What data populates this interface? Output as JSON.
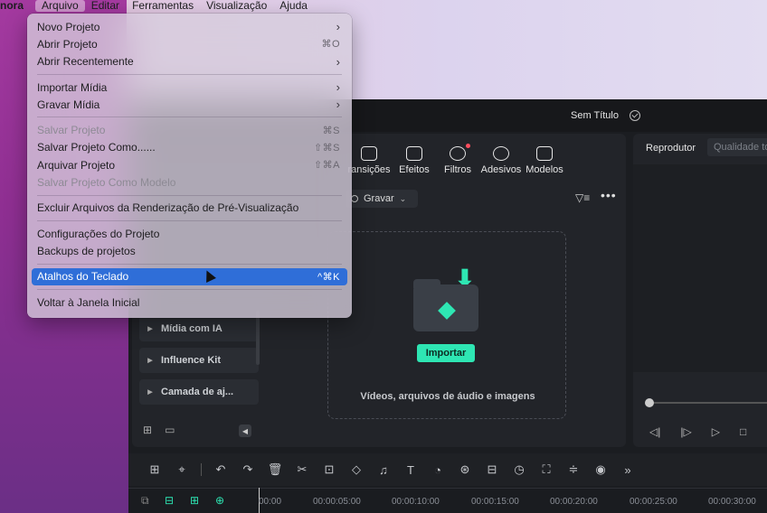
{
  "menubar": {
    "app": "nora",
    "items": [
      "Arquivo",
      "Editar",
      "Ferramentas",
      "Visualização",
      "Ajuda"
    ]
  },
  "file_menu": {
    "groups": [
      [
        {
          "label": "Novo Projeto",
          "shortcut": "",
          "submenu": true,
          "disabled": false
        },
        {
          "label": "Abrir Projeto",
          "shortcut": "⌘O",
          "submenu": false,
          "disabled": false
        },
        {
          "label": "Abrir Recentemente",
          "shortcut": "",
          "submenu": true,
          "disabled": false
        }
      ],
      [
        {
          "label": "Importar Mídia",
          "shortcut": "",
          "submenu": true,
          "disabled": false
        },
        {
          "label": "Gravar Mídia",
          "shortcut": "",
          "submenu": true,
          "disabled": false
        }
      ],
      [
        {
          "label": "Salvar Projeto",
          "shortcut": "⌘S",
          "submenu": false,
          "disabled": true
        },
        {
          "label": "Salvar Projeto Como......",
          "shortcut": "⇧⌘S",
          "submenu": false,
          "disabled": false
        },
        {
          "label": "Arquivar Projeto",
          "shortcut": "⇧⌘A",
          "submenu": false,
          "disabled": false
        },
        {
          "label": "Salvar Projeto Como Modelo",
          "shortcut": "",
          "submenu": false,
          "disabled": true
        }
      ],
      [
        {
          "label": "Excluir Arquivos da Renderização de Pré-Visualização",
          "shortcut": "",
          "submenu": false,
          "disabled": false
        }
      ],
      [
        {
          "label": "Configurações do Projeto",
          "shortcut": "",
          "submenu": false,
          "disabled": false
        },
        {
          "label": "Backups de projetos",
          "shortcut": "",
          "submenu": false,
          "disabled": false
        }
      ],
      [
        {
          "label": "Atalhos do Teclado",
          "shortcut": "^⌘K",
          "submenu": false,
          "disabled": false,
          "highlighted": true
        }
      ],
      [
        {
          "label": "Voltar à Janela Inicial",
          "shortcut": "",
          "submenu": false,
          "disabled": false
        }
      ]
    ]
  },
  "window": {
    "title": "Sem Título"
  },
  "media_tabs": [
    "ransições",
    "Efeitos",
    "Filtros",
    "Adesivos",
    "Modelos"
  ],
  "record": {
    "label": "Gravar"
  },
  "sidebar": {
    "items": [
      "Mídia com IA",
      "Influence Kit",
      "Camada de aj..."
    ]
  },
  "dropzone": {
    "button": "Importar",
    "hint": "Vídeos, arquivos de áudio e imagens"
  },
  "player": {
    "label": "Reprodutor",
    "quality_placeholder": "Qualidade to"
  },
  "timeline": {
    "marks": [
      "00:00",
      "00:00:05:00",
      "00:00:10:00",
      "00:00:15:00",
      "00:00:20:00",
      "00:00:25:00",
      "00:00:30:00"
    ]
  },
  "colors": {
    "accent": "#2ee6b3",
    "highlight": "#2f6ed8",
    "notification": "#ff4d5e"
  }
}
